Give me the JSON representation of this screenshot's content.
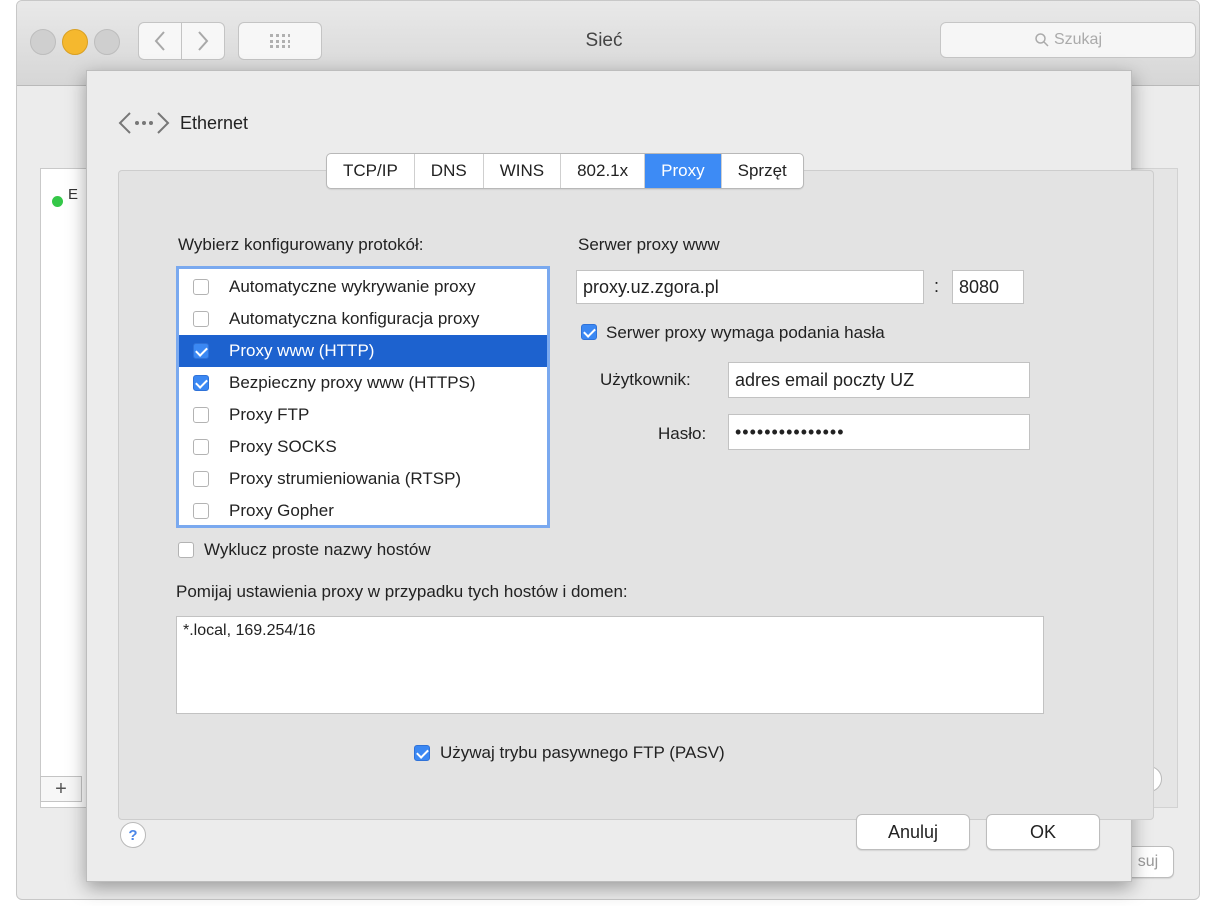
{
  "window": {
    "title": "Sieć",
    "search_placeholder": "Szukaj"
  },
  "sheet": {
    "service_name": "Ethernet",
    "tabs": [
      {
        "label": "TCP/IP"
      },
      {
        "label": "DNS"
      },
      {
        "label": "WINS"
      },
      {
        "label": "802.1x"
      },
      {
        "label": "Proxy",
        "active": true
      },
      {
        "label": "Sprzęt"
      }
    ],
    "protocols_label": "Wybierz konfigurowany protokół:",
    "protocols": [
      {
        "label": "Automatyczne wykrywanie proxy",
        "checked": false
      },
      {
        "label": "Automatyczna konfiguracja proxy",
        "checked": false
      },
      {
        "label": "Proxy www (HTTP)",
        "checked": true,
        "selected": true
      },
      {
        "label": "Bezpieczny proxy www (HTTPS)",
        "checked": true
      },
      {
        "label": "Proxy FTP",
        "checked": false
      },
      {
        "label": "Proxy SOCKS",
        "checked": false
      },
      {
        "label": "Proxy strumieniowania (RTSP)",
        "checked": false
      },
      {
        "label": "Proxy Gopher",
        "checked": false
      }
    ],
    "server_label": "Serwer proxy www",
    "server_value": "proxy.uz.zgora.pl",
    "port_separator": ":",
    "port_value": "8080",
    "requires_password_label": "Serwer proxy wymaga podania hasła",
    "requires_password_checked": true,
    "user_label": "Użytkownik:",
    "user_value": "adres email poczty UZ",
    "password_label": "Hasło:",
    "password_value": "•••••••••••••••",
    "exclude_simple_label": "Wyklucz proste nazwy hostów",
    "exclude_simple_checked": false,
    "bypass_label": "Pomijaj ustawienia proxy w przypadku tych hostów i domen:",
    "bypass_value": "*.local, 169.254/16",
    "pasv_label": "Używaj trybu pasywnego FTP (PASV)",
    "pasv_checked": true,
    "cancel_label": "Anuluj",
    "ok_label": "OK",
    "help_glyph": "?"
  },
  "background": {
    "add_glyph": "+",
    "partial_letter": "E",
    "partial_button": "suj",
    "status_color": "#34c748"
  },
  "icons": {
    "back": "chevron-left-icon",
    "forward": "chevron-right-icon",
    "grid": "grid-icon",
    "search": "search-icon",
    "network": "ethernet-icon"
  }
}
